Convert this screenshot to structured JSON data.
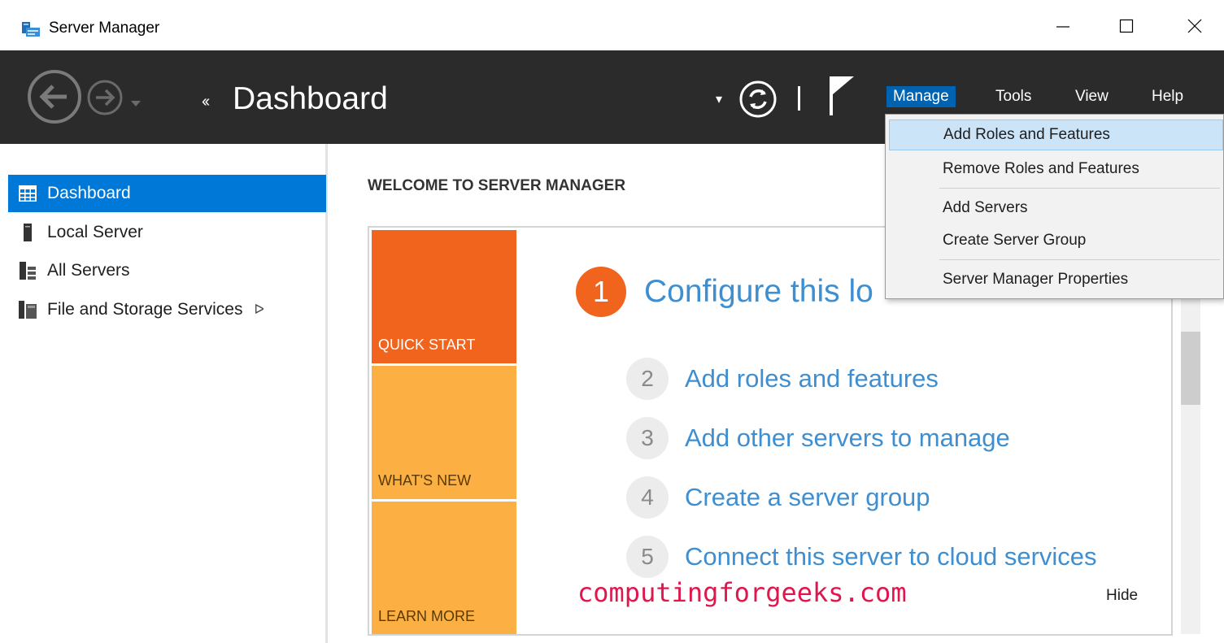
{
  "window": {
    "title": "Server Manager",
    "icons": {
      "app": "server-manager-icon",
      "minimize": "minimize-icon",
      "maximize": "maximize-icon",
      "close": "close-icon"
    }
  },
  "toolbar": {
    "breadcrumb_arrows": "‹‹",
    "title": "Dashboard",
    "dropdown_caret": "▾",
    "icons": {
      "back": "back-arrow-icon",
      "forward": "forward-arrow-icon",
      "history": "history-dropdown-icon",
      "refresh": "refresh-icon",
      "flag": "notification-flag-icon"
    },
    "menus": [
      "Manage",
      "Tools",
      "View",
      "Help"
    ]
  },
  "sidebar": {
    "items": [
      {
        "label": "Dashboard",
        "icon": "dashboard-grid-icon",
        "active": true
      },
      {
        "label": "Local Server",
        "icon": "local-server-icon",
        "active": false
      },
      {
        "label": "All Servers",
        "icon": "all-servers-icon",
        "active": false
      },
      {
        "label": "File and Storage Services",
        "icon": "file-storage-icon",
        "active": false,
        "has_submenu": true
      }
    ],
    "submenu_arrow": "ᐅ"
  },
  "main": {
    "heading": "WELCOME TO SERVER MANAGER",
    "tiles": [
      "QUICK START",
      "WHAT'S NEW",
      "LEARN MORE"
    ],
    "step1": {
      "number": "1",
      "text": "Configure this lo"
    },
    "steps": [
      {
        "number": "2",
        "text": "Add roles and features"
      },
      {
        "number": "3",
        "text": "Add other servers to manage"
      },
      {
        "number": "4",
        "text": "Create a server group"
      },
      {
        "number": "5",
        "text": "Connect this server to cloud services"
      }
    ],
    "hide_label": "Hide",
    "watermark": "computingforgeeks.com"
  },
  "manage_menu": {
    "items": [
      {
        "label": "Add Roles and Features",
        "highlighted": true
      },
      {
        "label": "Remove Roles and Features",
        "highlighted": false
      },
      {
        "label": "Add Servers",
        "highlighted": false
      },
      {
        "label": "Create Server Group",
        "highlighted": false
      },
      {
        "label": "Server Manager Properties",
        "highlighted": false
      }
    ]
  },
  "colors": {
    "toolbar_bg": "#2b2b2b",
    "accent_blue": "#0078d7",
    "menu_active": "#0063b1",
    "quick_start": "#f0641e",
    "whats_new": "#fcaf43",
    "link_blue": "#3f8fd0",
    "watermark": "#e0174c"
  }
}
